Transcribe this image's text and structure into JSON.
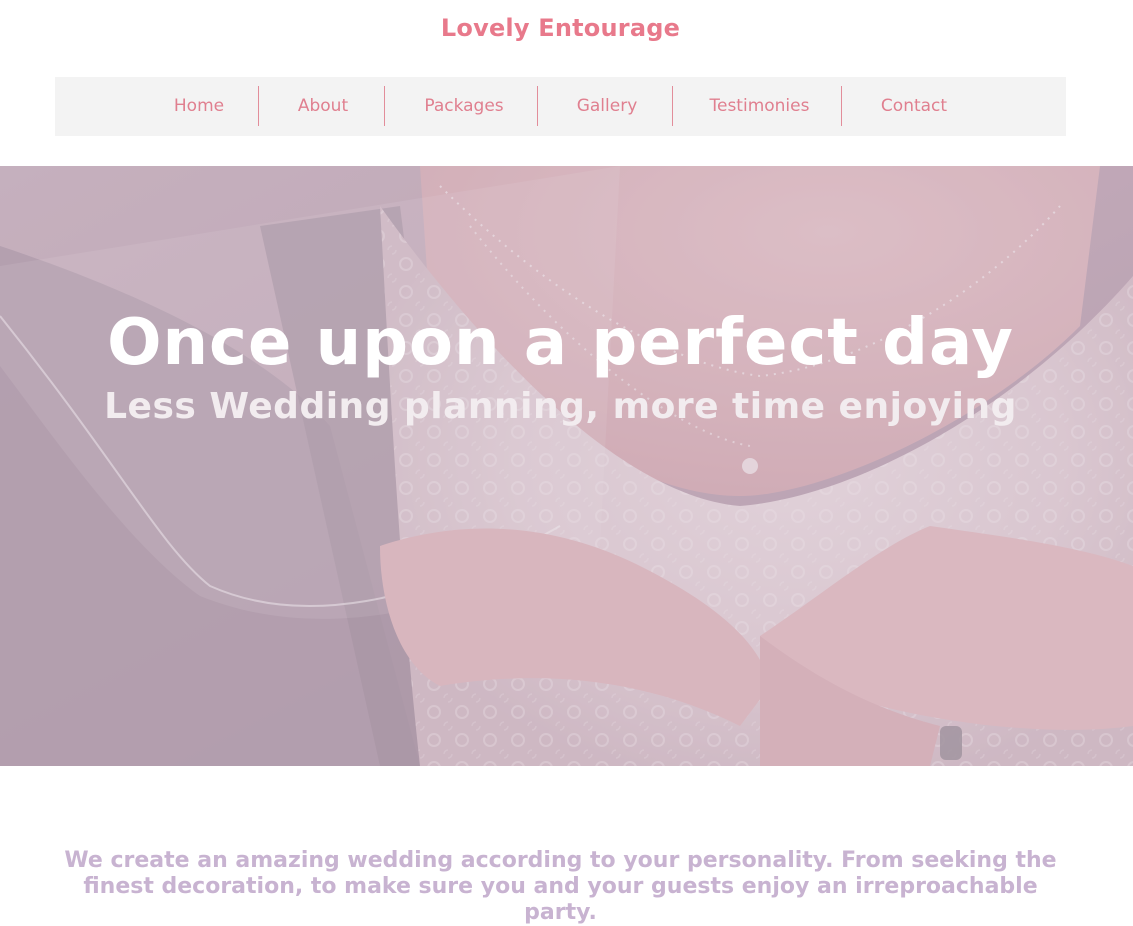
{
  "brand": {
    "title": "Lovely Entourage",
    "color": "#e8798b"
  },
  "nav": {
    "items": [
      {
        "label": "Home"
      },
      {
        "label": "About"
      },
      {
        "label": "Packages"
      },
      {
        "label": "Gallery"
      },
      {
        "label": "Testimonies"
      },
      {
        "label": "Contact"
      }
    ]
  },
  "hero": {
    "title": "Once upon a perfect day",
    "subtitle": "Less Wedding planning, more time enjoying"
  },
  "intro": {
    "text": "We create an amazing wedding according to your personality. From seeking the finest decoration, to make sure you and your guests enjoy an irreproachable party."
  }
}
